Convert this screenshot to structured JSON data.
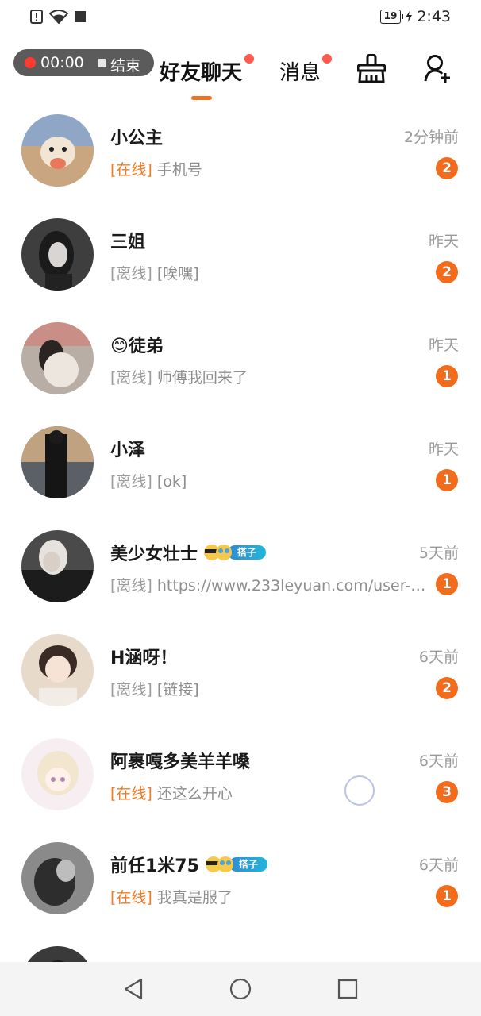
{
  "status_bar": {
    "battery": "19",
    "time": "2:43"
  },
  "recording": {
    "elapsed": "00:00",
    "end_label": "结束"
  },
  "header": {
    "tabs": [
      {
        "label": "好友聊天",
        "active": true,
        "has_dot": true
      },
      {
        "label": "消息",
        "active": false,
        "has_dot": true
      }
    ],
    "icons": [
      "clean-icon",
      "add-friend-icon"
    ]
  },
  "colors": {
    "accent": "#f36f21",
    "online": "#f07a23",
    "badge": "#f36c1b",
    "dot": "#ff5a4e"
  },
  "chats": [
    {
      "name": "小公主",
      "time": "2分钟前",
      "status": "[在线]",
      "online": true,
      "message": "手机号",
      "unread": "2"
    },
    {
      "name": "三姐",
      "time": "昨天",
      "status": "[离线]",
      "online": false,
      "message": "[唉嘿]",
      "unread": "2"
    },
    {
      "name": "😊徒弟",
      "time": "昨天",
      "status": "[离线]",
      "online": false,
      "message": "师傅我回来了",
      "unread": "1"
    },
    {
      "name": "小泽",
      "time": "昨天",
      "status": "[离线]",
      "online": false,
      "message": "[ok]",
      "unread": "1"
    },
    {
      "name": "美少女壮士",
      "time": "5天前",
      "status": "[离线]",
      "online": false,
      "message": "https://www.233leyuan.com/user-cen...",
      "unread": "1",
      "tag": "搭子"
    },
    {
      "name": "H涵呀！",
      "time": "6天前",
      "status": "[离线]",
      "online": false,
      "message": "[链接]",
      "unread": "2"
    },
    {
      "name": "阿裹嘎多美羊羊嗓",
      "time": "6天前",
      "status": "[在线]",
      "online": true,
      "message": "还这么开心",
      "unread": "3"
    },
    {
      "name": "前任1米75",
      "time": "6天前",
      "status": "[在线]",
      "online": true,
      "message": "我真是服了",
      "unread": "1",
      "tag": "搭子"
    },
    {
      "name": "",
      "time": "",
      "status": "",
      "online": false,
      "message": "",
      "unread": ""
    }
  ]
}
